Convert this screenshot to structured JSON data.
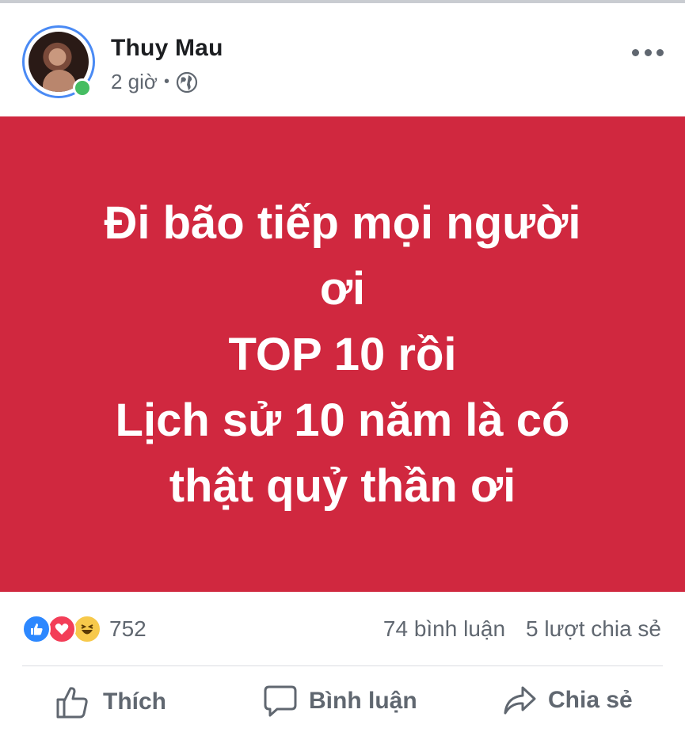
{
  "post": {
    "author": "Thuy Mau",
    "time": "2 giờ",
    "separator": "•",
    "banner_color": "#d0283f",
    "banner_lines": [
      "Đi bão tiếp mọi người",
      "ơi",
      "TOP 10 rồi",
      "Lịch sử 10 năm là có",
      "thật quỷ thần ơi"
    ]
  },
  "stats": {
    "reaction_count": "752",
    "comments": "74 bình luận",
    "shares": "5 lượt chia sẻ"
  },
  "actions": {
    "like": "Thích",
    "comment": "Bình luận",
    "share": "Chia sẻ"
  },
  "icons": {
    "privacy": "globe-icon",
    "menu": "more-icon",
    "reactions": [
      "like-reaction-icon",
      "love-reaction-icon",
      "haha-reaction-icon"
    ],
    "like": "thumbs-up-icon",
    "comment": "speech-bubble-icon",
    "share": "share-arrow-icon"
  },
  "colors": {
    "accent": "#2d88ff",
    "online": "#45bd62",
    "love": "#f33e58",
    "haha": "#f7c94b",
    "secondary_text": "#606770"
  }
}
